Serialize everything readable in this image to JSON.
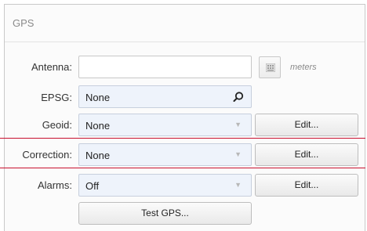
{
  "panel": {
    "title": "GPS"
  },
  "antenna": {
    "label": "Antenna:",
    "value": "",
    "units": "meters"
  },
  "epsg": {
    "label": "EPSG:",
    "value": "None"
  },
  "geoid": {
    "label": "Geoid:",
    "value": "None",
    "edit_label": "Edit..."
  },
  "correction": {
    "label": "Correction:",
    "value": "None",
    "edit_label": "Edit..."
  },
  "alarms": {
    "label": "Alarms:",
    "value": "Off",
    "edit_label": "Edit..."
  },
  "test_button": {
    "label": "Test GPS..."
  },
  "colors": {
    "highlight": "#c8102e",
    "field_blue": "#eef3fb"
  },
  "icons": {
    "epsg_search": "search-icon",
    "antenna_calc": "calculator-icon",
    "dropdown": "chevron-down-icon"
  }
}
